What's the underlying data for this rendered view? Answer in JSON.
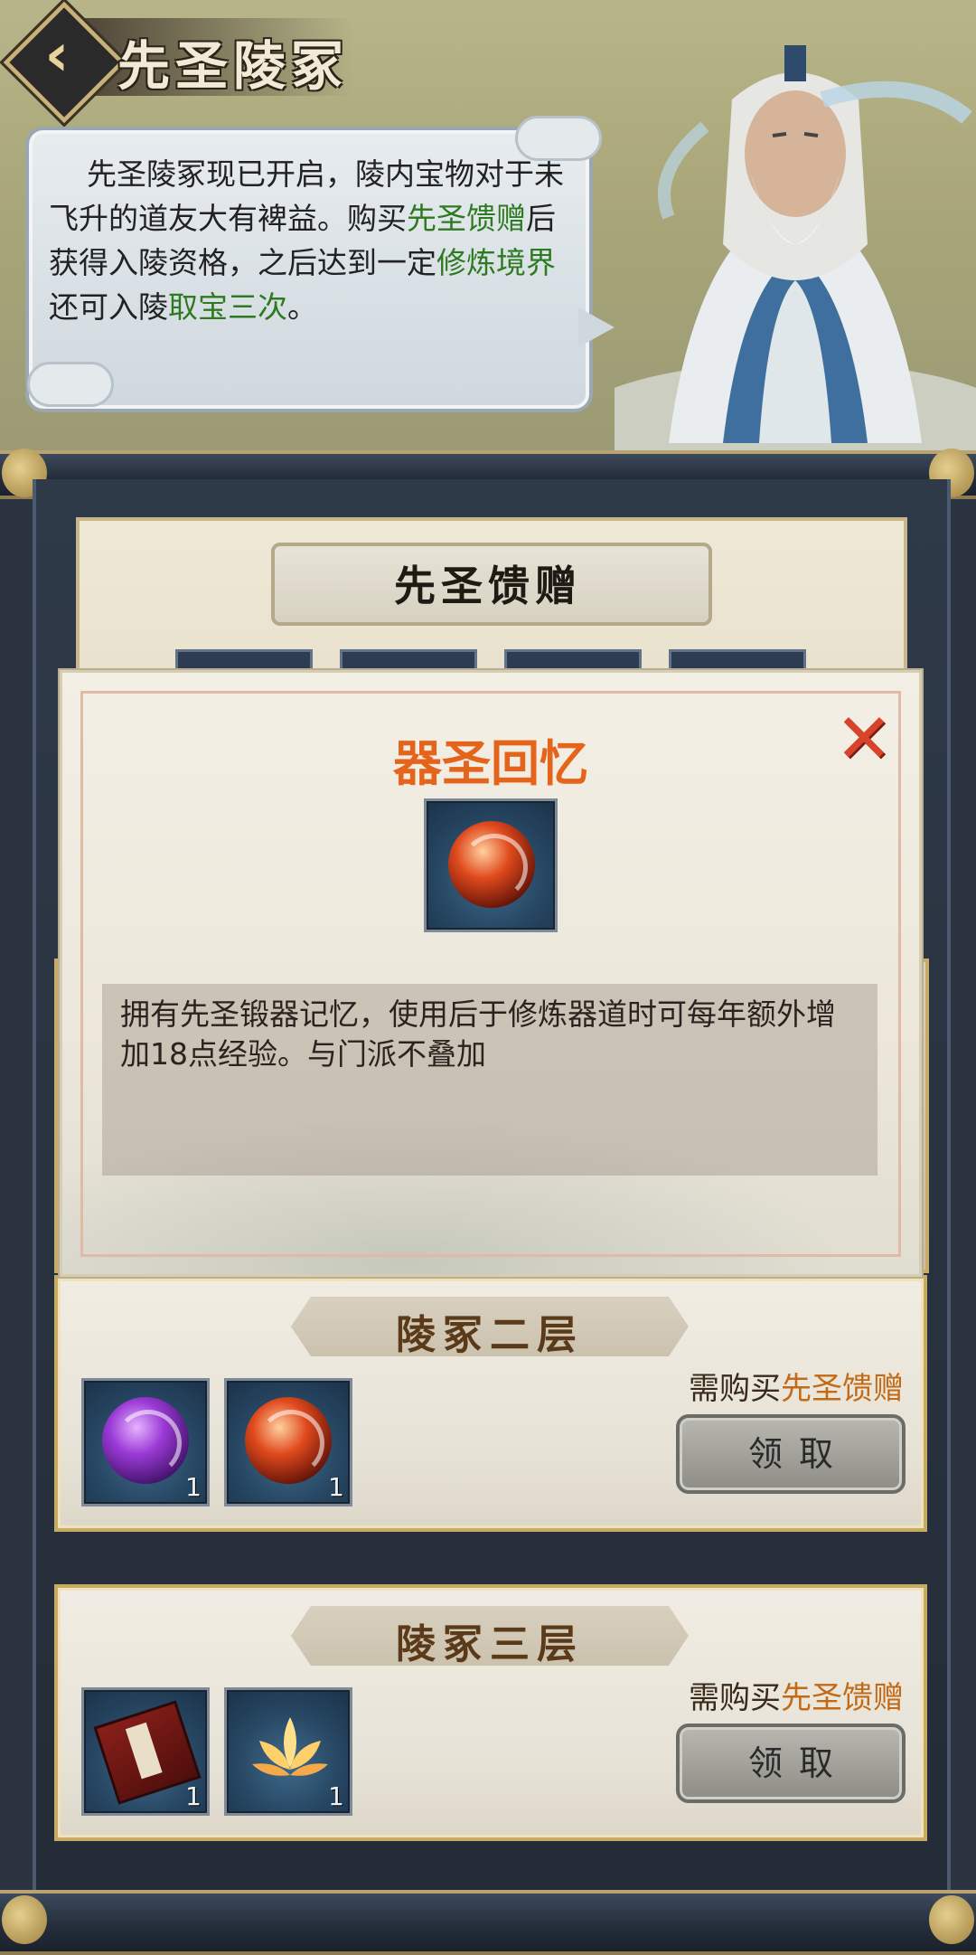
{
  "header": {
    "title": "先圣陵冢",
    "back_label": "‹",
    "speech": {
      "part1": "先圣陵冢现已开启，陵内宝物对于未飞升的道友大有裨益。购买",
      "link1": "先圣馈赠",
      "part2": "后获得入陵资格，之后达到一定",
      "link2": "修炼境界",
      "part3": "还可入陵",
      "link3": "取宝三次",
      "part4": "。"
    }
  },
  "gift_panel": {
    "title": "先圣馈赠"
  },
  "floors": [
    {
      "title": "陵冢二层",
      "requirement_prefix": "需购买",
      "requirement_item": "先圣馈赠",
      "claim_label": "领取",
      "items": [
        {
          "icon": "purple-orb-icon",
          "count": "1"
        },
        {
          "icon": "red-orb-icon",
          "count": "1"
        }
      ]
    },
    {
      "title": "陵冢三层",
      "requirement_prefix": "需购买",
      "requirement_item": "先圣馈赠",
      "claim_label": "领取",
      "items": [
        {
          "icon": "red-book-icon",
          "count": "1"
        },
        {
          "icon": "golden-lotus-icon",
          "count": "1"
        }
      ]
    }
  ],
  "modal": {
    "title": "器圣回忆",
    "close_label": "✕",
    "item_icon": "red-orb-icon",
    "description": "拥有先圣锻器记忆，使用后于修炼器道时可每年额外增加18点经验。与门派不叠加"
  },
  "colors": {
    "modal_title": "#e5641c",
    "link_green": "#2e7a21",
    "req_orange": "#c26a16",
    "close_red": "#d8432c"
  }
}
